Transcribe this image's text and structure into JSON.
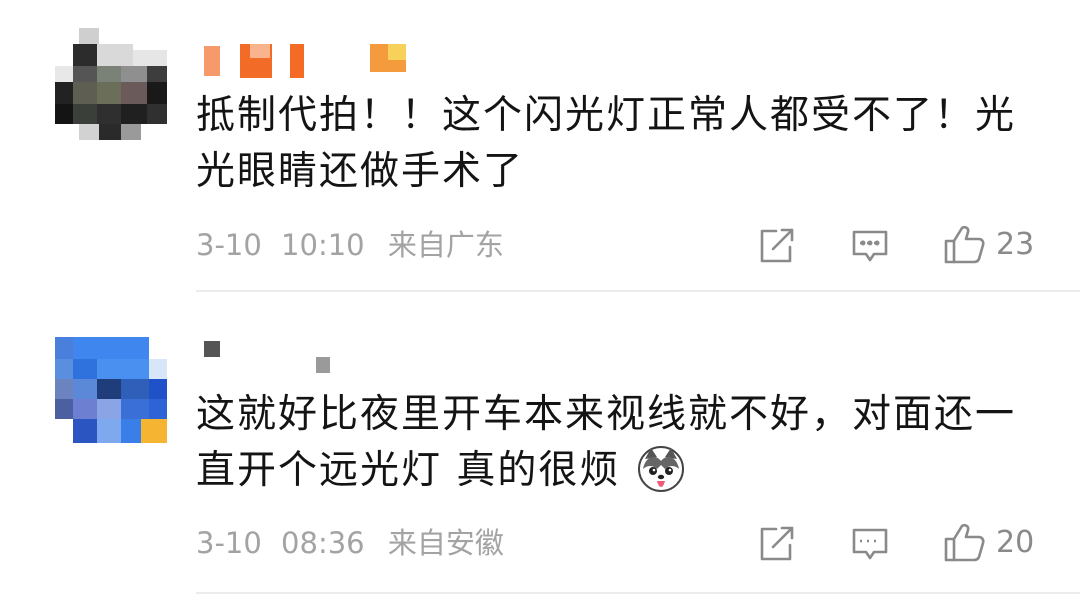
{
  "comments": [
    {
      "username": "",
      "text_line1": "抵制代拍！！这个闪光灯正常人都受不了！光",
      "text_line2": "光眼睛还做手术了",
      "date": "3-10",
      "time": "10:10",
      "location": "来自广东",
      "likes": "23"
    },
    {
      "username": "",
      "text_line1": "这就好比夜里开车本来视线就不好，对面还一",
      "text_line2": "直开个远光灯  真的很烦",
      "emoji": "husky-emoji",
      "date": "3-10",
      "time": "08:36",
      "location": "来自安徽",
      "likes": "20"
    }
  ],
  "icons": {
    "repost": "share-edit-icon",
    "comment": "comment-icon",
    "like": "thumbs-up-icon"
  },
  "colors": {
    "meta_text": "#a3a3a3",
    "icon": "#8a8a8a",
    "divider": "#ececec"
  }
}
